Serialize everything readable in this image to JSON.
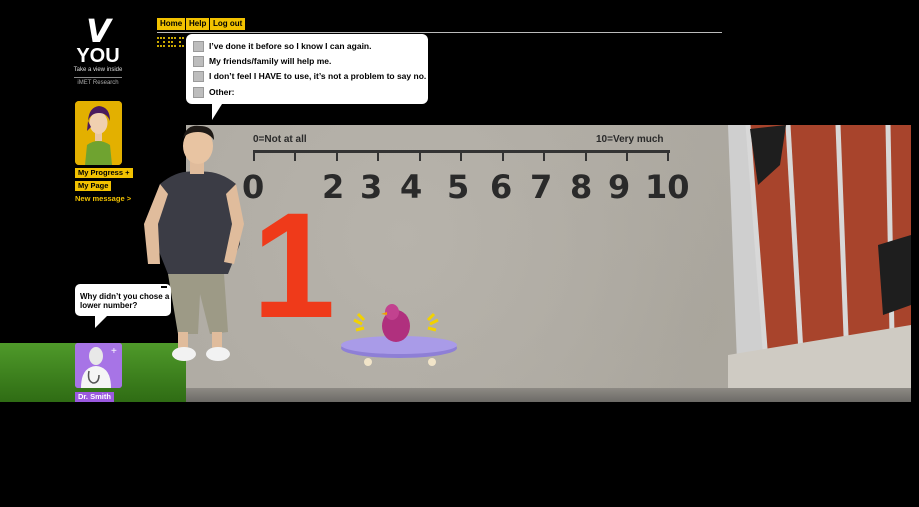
{
  "logo": {
    "v": "V",
    "you": "YOU",
    "tagline": "Take a view inside",
    "org": "iMET Research"
  },
  "nav": {
    "home": "Home",
    "help": "Help",
    "logout": "Log out"
  },
  "sidebar": {
    "progress": "My Progress",
    "progress_plus": "+",
    "mypage": "My Page",
    "newmessage": "New message >"
  },
  "bubble": {
    "options": [
      "I’ve done it before so I know I can again.",
      "My friends/family will help me.",
      "I don’t feel I HAVE to use, it’s not a problem to say no.",
      "Other:"
    ]
  },
  "scale": {
    "left_label": "0=Not at all",
    "right_label": "10=Very much",
    "numbers": [
      "0",
      "2",
      "3",
      "4",
      "5",
      "6",
      "7",
      "8",
      "9",
      "10"
    ],
    "selected": "1"
  },
  "doctor": {
    "question": "Why didn’t you chose a lower number?",
    "name": "Dr. Smith",
    "plus": "+"
  },
  "colors": {
    "accent": "#f2c200",
    "doctor": "#9b59e0",
    "selected_number": "#ef3a1a"
  }
}
